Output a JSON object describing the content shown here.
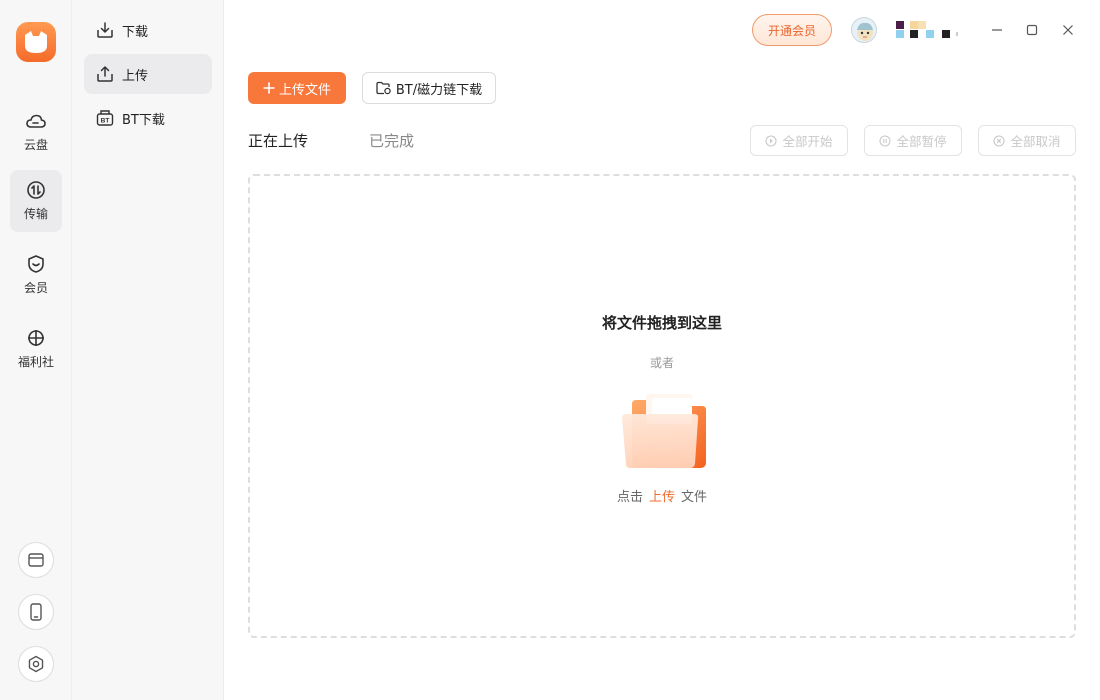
{
  "rail": {
    "items": [
      {
        "label": "云盘",
        "icon": "cloud-icon"
      },
      {
        "label": "传输",
        "icon": "transfer-icon",
        "active": true
      },
      {
        "label": "会员",
        "icon": "member-shield-icon"
      },
      {
        "label": "福利社",
        "icon": "welfare-icon"
      }
    ],
    "bottom": [
      "window-icon",
      "phone-icon",
      "settings-icon"
    ]
  },
  "subnav": {
    "items": [
      {
        "label": "下载",
        "icon": "download-icon"
      },
      {
        "label": "上传",
        "icon": "upload-icon",
        "active": true
      },
      {
        "label": "BT下载",
        "icon": "bt-icon"
      }
    ]
  },
  "topbar": {
    "vip_label": "开通会员"
  },
  "toolbar": {
    "upload_label": "上传文件",
    "bt_label": "BT/磁力链下载"
  },
  "tabs": {
    "uploading": "正在上传",
    "completed": "已完成"
  },
  "actions": {
    "start_all": "全部开始",
    "pause_all": "全部暂停",
    "cancel_all": "全部取消"
  },
  "dropzone": {
    "title": "将文件拖拽到这里",
    "or": "或者",
    "hint_prefix": "点击",
    "hint_link": "上传",
    "hint_suffix": "文件"
  },
  "colors": {
    "accent": "#f8773b",
    "link": "#f06c2e",
    "disabled": "#c8c8c8"
  }
}
